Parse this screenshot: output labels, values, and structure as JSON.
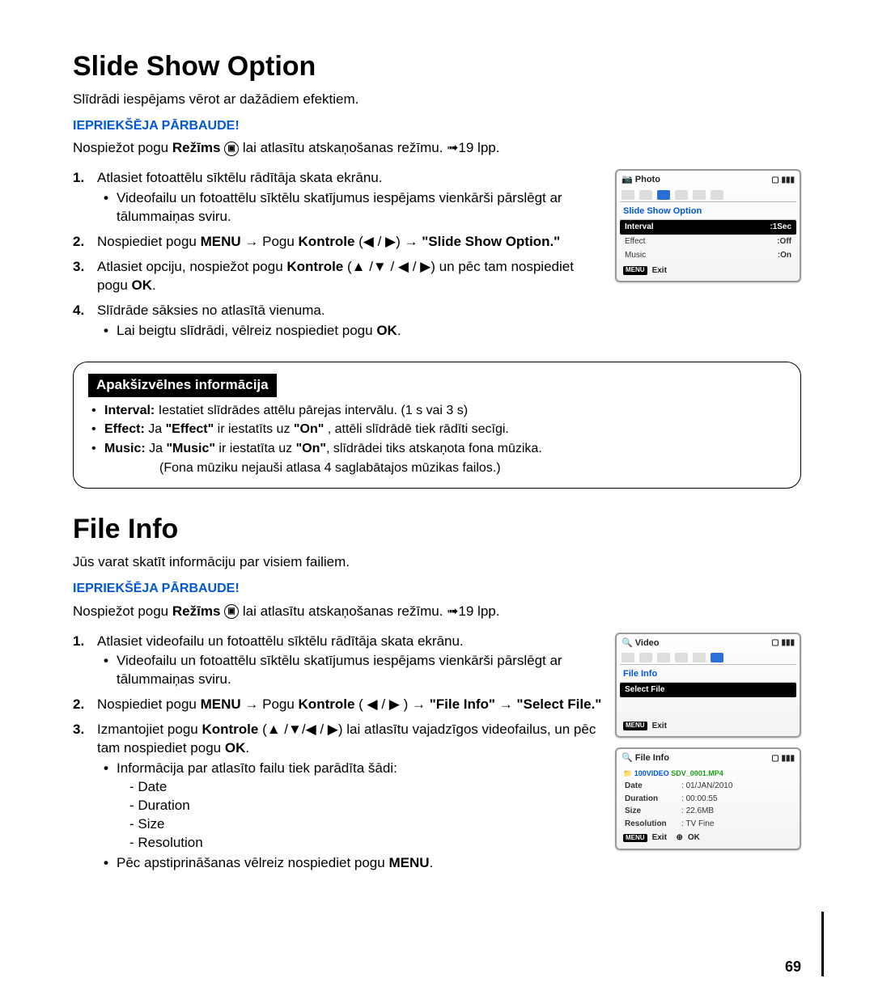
{
  "page_number": "69",
  "section1": {
    "title": "Slide Show Option",
    "intro": "Slīdrādi iespējams vērot ar dažādiem efektiem.",
    "precheck_label": "IEPRIEKŠĒJA PĀRBAUDE!",
    "precheck_text_pre": "Nospiežot pogu ",
    "precheck_bold": "Režīms",
    "precheck_text_post": " lai atlasītu atskaņošanas režīmu. ",
    "precheck_page": "19 lpp.",
    "step1": "Atlasiet fotoattēlu sīktēlu rādītāja skata ekrānu.",
    "step1_sub": "Videofailu un fotoattēlu sīktēlu skatījumus iespējams vienkārši pārslēgt ar tālummaiņas sviru.",
    "step2_pre": "Nospiediet pogu ",
    "step2_menu": "MENU",
    "step2_mid": " → Pogu ",
    "step2_kontrole": "Kontrole",
    "step2_arrows": " (◀ / ▶) → ",
    "step2_option": "\"Slide Show Option.\"",
    "step3_pre": "Atlasiet opciju, nospiežot pogu ",
    "step3_kontrole": "Kontrole",
    "step3_arrows": " (▲ /▼ / ◀ / ▶) un pēc tam nospiediet pogu ",
    "step3_ok": "OK",
    "step4": "Slīdrāde sāksies no atlasītā vienuma.",
    "step4_sub_pre": "Lai beigtu slīdrādi, vēlreiz nospiediet pogu ",
    "step4_sub_ok": "OK",
    "info": {
      "title": "Apakšizvēlnes informācija",
      "interval_label": "Interval:",
      "interval_text": " Iestatiet slīdrādes attēlu pārejas intervālu. (1 s vai 3 s)",
      "effect_label": "Effect:",
      "effect_text_pre": " Ja ",
      "effect_q1": "\"Effect\"",
      "effect_mid": " ir iestatīts uz ",
      "effect_q2": "\"On\"",
      "effect_post": " , attēli slīdrādē tiek rādīti secīgi.",
      "music_label": "Music:",
      "music_pre": " Ja ",
      "music_q1": "\"Music\"",
      "music_mid": " ir iestatīta uz ",
      "music_q2": "\"On\"",
      "music_post": ", slīdrādei tiks atskaņota fona mūzika.",
      "music_note": "(Fona mūziku nejauši atlasa 4 saglabātajos mūzikas failos.)"
    },
    "screen": {
      "mode": "Photo",
      "header": "Slide Show Option",
      "rows": [
        {
          "label": "Interval",
          "value": ":1Sec",
          "selected": true
        },
        {
          "label": "Effect",
          "value": ":Off",
          "selected": false
        },
        {
          "label": "Music",
          "value": ":On",
          "selected": false
        }
      ],
      "menu_btn": "MENU",
      "exit": "Exit"
    }
  },
  "section2": {
    "title": "File Info",
    "intro": "Jūs varat skatīt informāciju par visiem failiem.",
    "precheck_label": "IEPRIEKŠĒJA PĀRBAUDE!",
    "precheck_text_pre": "Nospiežot pogu ",
    "precheck_bold": "Režīms",
    "precheck_text_post": " lai atlasītu atskaņošanas režīmu. ",
    "precheck_page": "19 lpp.",
    "step1": "Atlasiet videofailu un fotoattēlu sīktēlu rādītāja skata ekrānu.",
    "step1_sub": "Videofailu un fotoattēlu sīktēlu skatījumus iespējams vienkārši pārslēgt ar tālummaiņas sviru.",
    "step2_pre": "Nospiediet pogu ",
    "step2_menu": "MENU",
    "step2_mid": " → Pogu ",
    "step2_kontrole": "Kontrole",
    "step2_arrows": " ( ◀ / ▶ ) → ",
    "step2_fi": "\"File Info\"",
    "step2_arrow2": " → ",
    "step2_sf": "\"Select File.\"",
    "step3_pre": "Izmantojiet pogu ",
    "step3_kontrole": "Kontrole",
    "step3_arrows": " (▲ /▼/◀ / ▶) lai atlasītu vajadzīgos videofailus, un pēc tam nospiediet pogu ",
    "step3_ok": "OK",
    "step3_sub": "Informācija par atlasīto failu tiek parādīta šādi:",
    "dash": [
      "Date",
      "Duration",
      "Size",
      "Resolution"
    ],
    "step3_after_pre": "Pēc apstiprināšanas vēlreiz nospiediet pogu ",
    "step3_after_menu": "MENU",
    "screen1": {
      "mode": "Video",
      "header": "File Info",
      "row_label": "Select File",
      "menu_btn": "MENU",
      "exit": "Exit"
    },
    "screen2": {
      "mode": "File Info",
      "folder": "100VIDEO",
      "file": "SDV_0001.MP4",
      "rows": [
        {
          "k": "Date",
          "v": "01/JAN/2010"
        },
        {
          "k": "Duration",
          "v": "00:00:55"
        },
        {
          "k": "Size",
          "v": "22.6MB"
        },
        {
          "k": "Resolution",
          "v": "TV Fine"
        }
      ],
      "menu_btn": "MENU",
      "exit": "Exit",
      "ok": "OK"
    }
  }
}
